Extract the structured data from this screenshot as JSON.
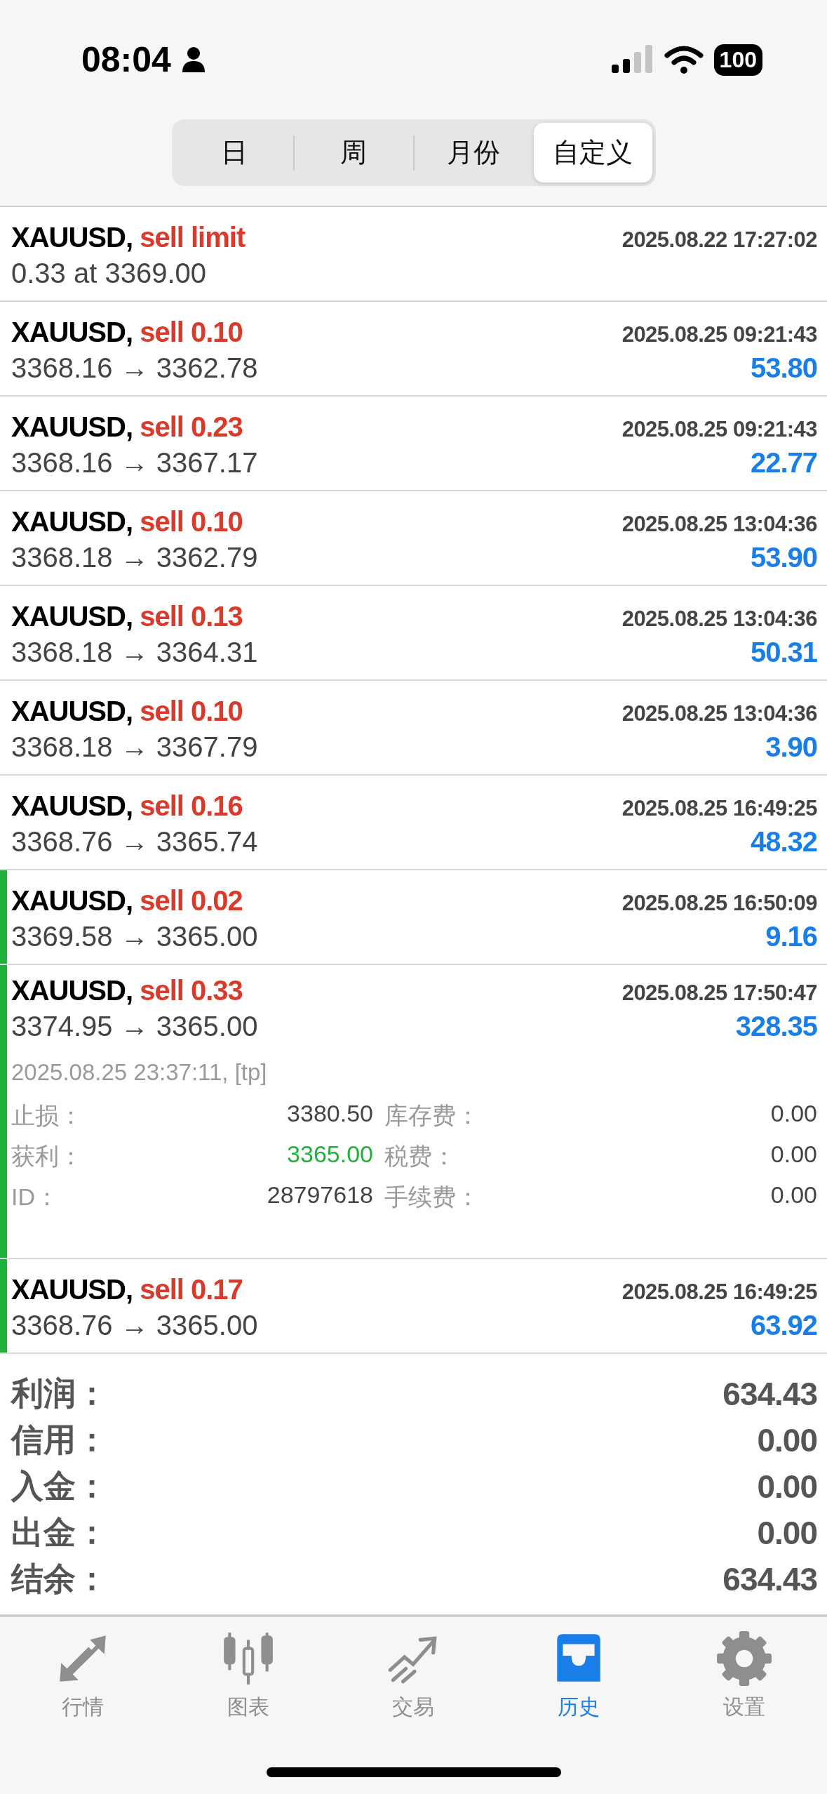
{
  "status_bar": {
    "time": "08:04",
    "battery": "100"
  },
  "period_tabs": [
    {
      "label": "日",
      "selected": false
    },
    {
      "label": "周",
      "selected": false
    },
    {
      "label": "月份",
      "selected": false
    },
    {
      "label": "自定义",
      "selected": true
    }
  ],
  "orders": [
    {
      "symbol": "XAUUSD,",
      "action": "sell limit",
      "time": "2025.08.22 17:27:02",
      "prices": "0.33 at 3369.00",
      "highlighted": false,
      "expanded": false
    },
    {
      "symbol": "XAUUSD,",
      "action": "sell 0.10",
      "time": "2025.08.25 09:21:43",
      "prices": "3368.16 → 3362.78",
      "profit": "53.80",
      "highlighted": false,
      "expanded": false
    },
    {
      "symbol": "XAUUSD,",
      "action": "sell 0.23",
      "time": "2025.08.25 09:21:43",
      "prices": "3368.16 → 3367.17",
      "profit": "22.77",
      "highlighted": false,
      "expanded": false
    },
    {
      "symbol": "XAUUSD,",
      "action": "sell 0.10",
      "time": "2025.08.25 13:04:36",
      "prices": "3368.18 → 3362.79",
      "profit": "53.90",
      "highlighted": false,
      "expanded": false
    },
    {
      "symbol": "XAUUSD,",
      "action": "sell 0.13",
      "time": "2025.08.25 13:04:36",
      "prices": "3368.18 → 3364.31",
      "profit": "50.31",
      "highlighted": false,
      "expanded": false
    },
    {
      "symbol": "XAUUSD,",
      "action": "sell 0.10",
      "time": "2025.08.25 13:04:36",
      "prices": "3368.18 → 3367.79",
      "profit": "3.90",
      "highlighted": false,
      "expanded": false
    },
    {
      "symbol": "XAUUSD,",
      "action": "sell 0.16",
      "time": "2025.08.25 16:49:25",
      "prices": "3368.76 → 3365.74",
      "profit": "48.32",
      "highlighted": false,
      "expanded": false
    },
    {
      "symbol": "XAUUSD,",
      "action": "sell 0.02",
      "time": "2025.08.25 16:50:09",
      "prices": "3369.58 → 3365.00",
      "profit": "9.16",
      "highlighted": true,
      "expanded": false
    },
    {
      "symbol": "XAUUSD,",
      "action": "sell 0.33",
      "time": "2025.08.25 17:50:47",
      "prices": "3374.95 → 3365.00",
      "profit": "328.35",
      "highlighted": true,
      "expanded": true,
      "details": {
        "close_time": "2025.08.25 23:37:11, [tp]",
        "fields": [
          {
            "label": "止损：",
            "value": "3380.50",
            "color": "#444444"
          },
          {
            "label": "库存费：",
            "value": "0.00",
            "color": "#444444"
          },
          {
            "label": "获利：",
            "value": "3365.00",
            "color": "#22b03c"
          },
          {
            "label": "税费：",
            "value": "0.00",
            "color": "#444444"
          },
          {
            "label": "ID：",
            "value": "28797618",
            "color": "#444444"
          },
          {
            "label": "手续费：",
            "value": "0.00",
            "color": "#444444"
          }
        ]
      }
    },
    {
      "symbol": "XAUUSD,",
      "action": "sell 0.17",
      "time": "2025.08.25 16:49:25",
      "prices": "3368.76 → 3365.00",
      "profit": "63.92",
      "highlighted": true,
      "expanded": false
    }
  ],
  "summary": [
    {
      "label": "利润：",
      "value": "634.43"
    },
    {
      "label": "信用：",
      "value": "0.00"
    },
    {
      "label": "入金：",
      "value": "0.00"
    },
    {
      "label": "出金：",
      "value": "0.00"
    },
    {
      "label": "结余：",
      "value": "634.43"
    }
  ],
  "bottom_nav": [
    {
      "kind": "quotes",
      "label": "行情",
      "selected": false
    },
    {
      "kind": "chart",
      "label": "图表",
      "selected": false
    },
    {
      "kind": "trade",
      "label": "交易",
      "selected": false
    },
    {
      "kind": "history",
      "label": "历史",
      "selected": true
    },
    {
      "kind": "settings",
      "label": "设置",
      "selected": false
    }
  ]
}
